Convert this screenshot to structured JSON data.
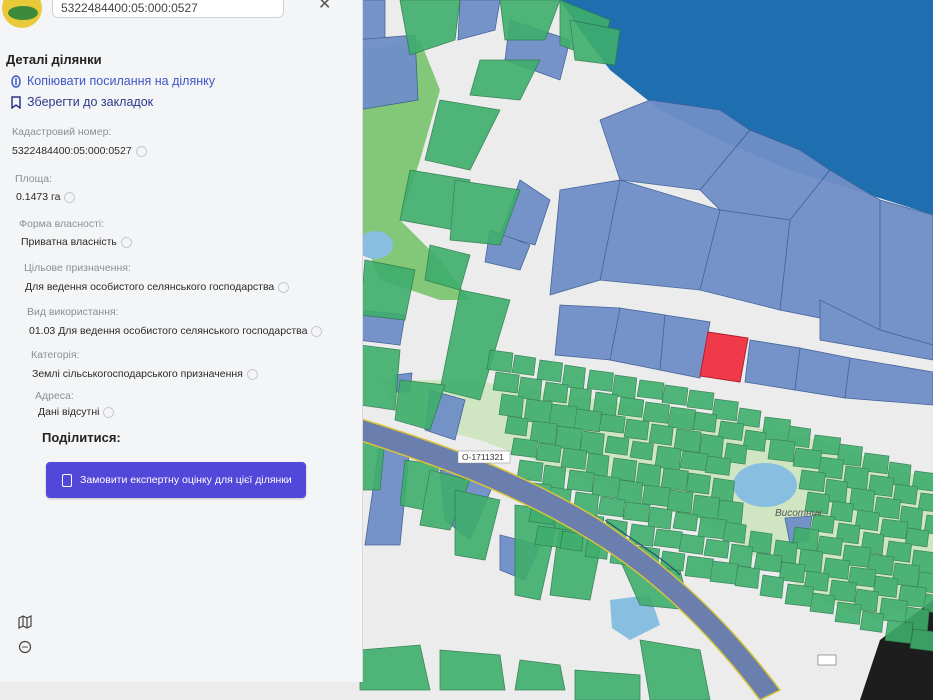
{
  "search": {
    "value": "5322484400:05:000:0527"
  },
  "panel": {
    "title": "Деталі ділянки",
    "copy_link": "Копіювати посилання на ділянку",
    "bookmark": "Зберегти до закладок",
    "fields": [
      {
        "label": "Кадастровий номер:",
        "value": "5322484400:05:000:0527"
      },
      {
        "label": "Площа:",
        "value": "0.1473 га"
      },
      {
        "label": "Форма власності:",
        "value": "Приватна власність"
      },
      {
        "label": "Цільове призначення:",
        "value": "Для ведення особистого селянського господарства"
      },
      {
        "label": "Вид використання:",
        "value": "01.03 Для ведення особистого селянського господарства"
      },
      {
        "label": "Категорія:",
        "value": "Землі сільськогосподарського призначення"
      },
      {
        "label": "Адреса:",
        "value": "Дані відсутні"
      }
    ],
    "share_heading": "Поділитися:",
    "order_button": "Замовити експертну оцінку для цієї ділянки"
  },
  "map": {
    "road_label": "О-1711321",
    "village_label": "Висотник",
    "icons": {
      "map": "map-icon",
      "chat": "chat-icon",
      "close": "close-icon",
      "link": "link-icon",
      "bookmark": "bookmark-icon",
      "document": "document-icon"
    },
    "colors": {
      "water": "#1f6fb0",
      "land": "#ececec",
      "agri_green": "#3fae6c",
      "state_blue": "#6f8fc8",
      "selected": "#f03a4a",
      "road": "#6a7fae",
      "road_edge": "#d8c33a",
      "forest": "#78c36c",
      "pond": "#88bfe0"
    }
  }
}
